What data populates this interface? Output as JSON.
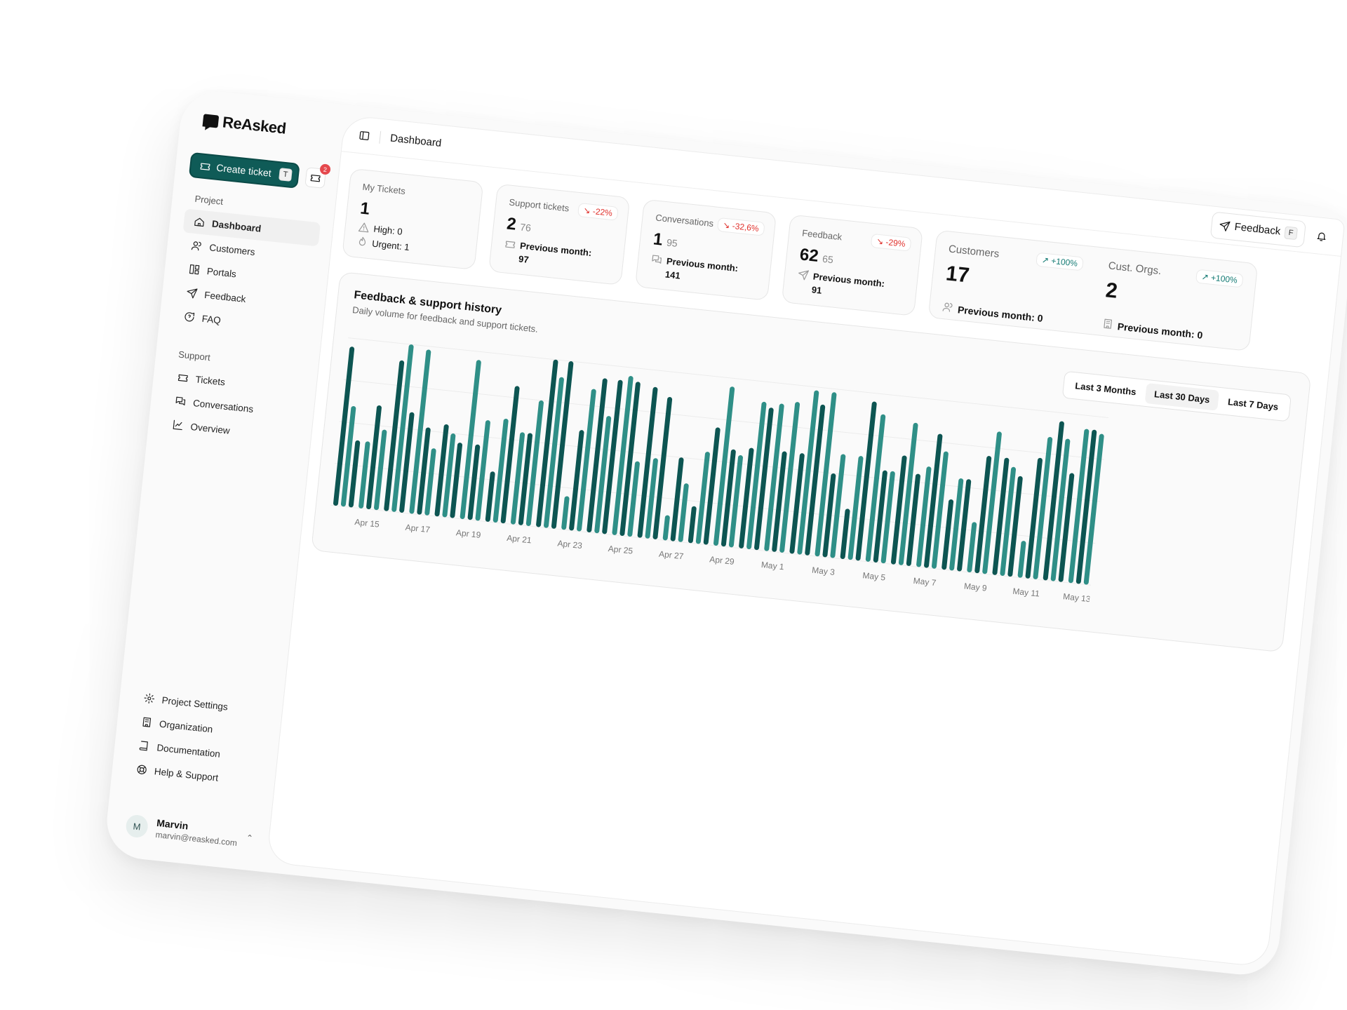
{
  "app": {
    "brand": "ReAsked"
  },
  "sidebar": {
    "create_ticket": "Create ticket",
    "create_shortcut": "T",
    "inbox_badge": "2",
    "groups": [
      {
        "title": "Project",
        "items": [
          "Dashboard",
          "Customers",
          "Portals",
          "Feedback",
          "FAQ"
        ]
      },
      {
        "title": "Support",
        "items": [
          "Tickets",
          "Conversations",
          "Overview"
        ]
      }
    ],
    "bottom_items": [
      "Project Settings",
      "Organization",
      "Documentation",
      "Help & Support"
    ],
    "user": {
      "initial": "M",
      "name": "Marvin",
      "email": "marvin@reasked.com"
    }
  },
  "topbar": {
    "title": "Dashboard",
    "feedback_label": "Feedback",
    "feedback_shortcut": "F"
  },
  "stats": {
    "my_tickets": {
      "title": "My Tickets",
      "value": "1",
      "high": "High: 0",
      "urgent": "Urgent: 1"
    },
    "support": {
      "title": "Support tickets",
      "value": "2",
      "prev_small": "76",
      "trend": "-22%",
      "prev_label": "Previous month:",
      "prev_value": "97"
    },
    "conversations": {
      "title": "Conversations",
      "value": "1",
      "prev_small": "95",
      "trend": "-32,6%",
      "prev_label": "Previous month:",
      "prev_value": "141"
    },
    "feedback": {
      "title": "Feedback",
      "value": "62",
      "prev_small": "65",
      "trend": "-29%",
      "prev_label": "Previous month:",
      "prev_value": "91"
    },
    "customers": {
      "title": "Customers",
      "value": "17",
      "trend": "+100%",
      "prev": "Previous month: 0"
    },
    "cust_orgs": {
      "title": "Cust. Orgs.",
      "value": "2",
      "trend": "+100%",
      "prev": "Previous month: 0"
    }
  },
  "chart_card": {
    "title": "Feedback & support history",
    "subtitle": "Daily volume for feedback and support tickets.",
    "ranges": [
      "Last 3 Months",
      "Last 30 Days",
      "Last 7 Days"
    ],
    "selected_range": "Last 30 Days"
  },
  "chart_data": {
    "type": "bar",
    "colors": [
      "#0d5552",
      "#2f8f87"
    ],
    "categories": [
      "Apr 14",
      "Apr 15",
      "Apr 16",
      "Apr 17",
      "Apr 18",
      "Apr 19",
      "Apr 20",
      "Apr 21",
      "Apr 22",
      "Apr 23",
      "Apr 24",
      "Apr 25",
      "Apr 26",
      "Apr 27",
      "Apr 28",
      "Apr 29",
      "Apr 30",
      "May 1",
      "May 2",
      "May 3",
      "May 4",
      "May 5",
      "May 6",
      "May 7",
      "May 8",
      "May 9",
      "May 10",
      "May 11",
      "May 12",
      "May 13"
    ],
    "tick_labels": [
      "Apr 15",
      "Apr 17",
      "Apr 19",
      "Apr 21",
      "Apr 23",
      "Apr 25",
      "Apr 27",
      "Apr 29",
      "May 1",
      "May 3",
      "May 5",
      "May 7",
      "May 9",
      "May 11",
      "May 13"
    ],
    "series": [
      {
        "values": [
          95,
          40,
          90,
          98,
          55,
          95,
          30,
          55,
          100,
          20,
          92,
          95,
          90,
          15,
          22,
          95,
          60,
          88,
          60,
          98,
          30,
          88,
          65,
          60,
          42,
          30,
          70,
          22,
          95,
          92
        ]
      },
      {
        "values": [
          60,
          62,
          100,
          52,
          50,
          45,
          62,
          55,
          90,
          60,
          70,
          92,
          48,
          50,
          55,
          58,
          88,
          60,
          98,
          50,
          62,
          55,
          85,
          80,
          55,
          70,
          65,
          72,
          85,
          92
        ]
      },
      {
        "values": [
          40,
          48,
          60,
          40,
          45,
          60,
          82,
          75,
          100,
          85,
          92,
          45,
          85,
          35,
          70,
          55,
          85,
          90,
          90,
          62,
          95,
          55,
          55,
          70,
          55,
          85,
          60,
          85,
          65,
          90
        ]
      }
    ],
    "ylim": [
      0,
      100
    ],
    "grid": true
  }
}
